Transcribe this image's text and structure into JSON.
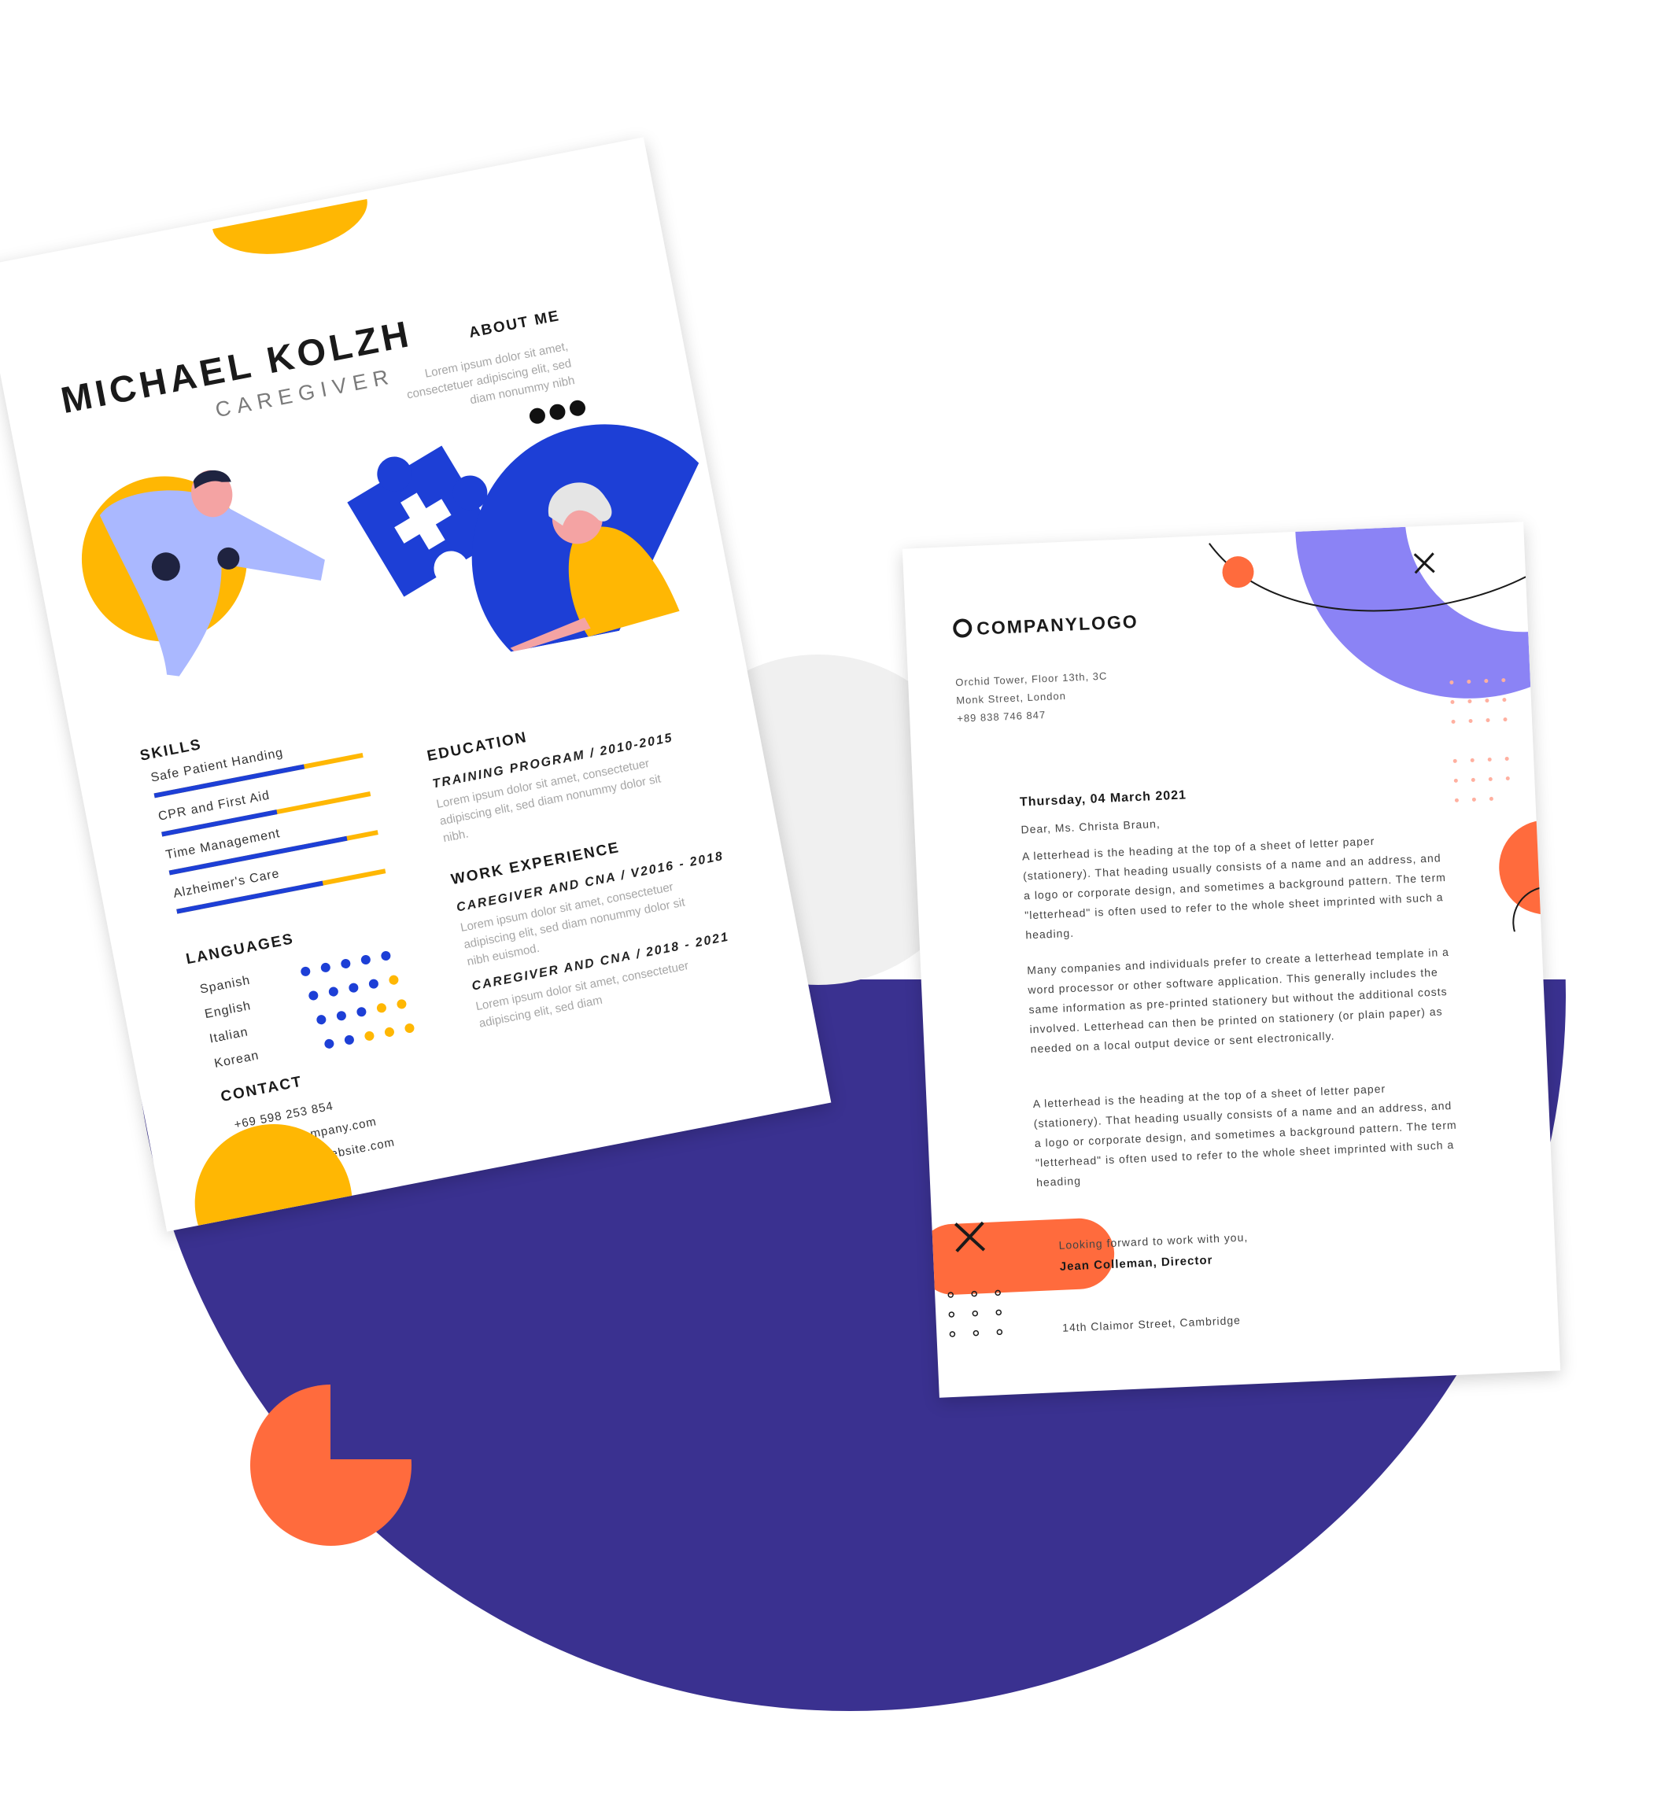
{
  "colors": {
    "navy": "#3a3190",
    "orange": "#ff6b3d",
    "yellow": "#ffb703",
    "blue": "#1d3fd6",
    "periwinkle": "#8b83f5"
  },
  "resume": {
    "name": "MICHAEL KOLZH",
    "role": "CAREGIVER",
    "about": {
      "heading": "ABOUT ME",
      "text": "Lorem ipsum dolor sit amet, consectetuer adipiscing elit, sed diam nonummy nibh",
      "social_icons": [
        "twitter-icon",
        "facebook-icon",
        "instagram-icon"
      ]
    },
    "skills": {
      "heading": "SKILLS",
      "items": [
        {
          "label": "Safe Patient Handing",
          "level": 0.72
        },
        {
          "label": "CPR and First Aid",
          "level": 0.55
        },
        {
          "label": "Time Management",
          "level": 0.85
        },
        {
          "label": "Alzheimer's Care",
          "level": 0.7
        }
      ]
    },
    "languages": {
      "heading": "LANGUAGES",
      "items": [
        {
          "label": "Spanish",
          "level": 5
        },
        {
          "label": "English",
          "level": 4
        },
        {
          "label": "Italian",
          "level": 3
        },
        {
          "label": "Korean",
          "level": 2
        }
      ],
      "max": 5
    },
    "education": {
      "heading": "EDUCATION",
      "title": "TRAINING PROGRAM  / 2010-2015",
      "text": "Lorem ipsum dolor sit amet, consectetuer adipiscing elit, sed diam nonummy dolor sit nibh."
    },
    "work": {
      "heading": "WORK EXPERIENCE",
      "jobs": [
        {
          "title": "CAREGIVER AND CNA / V2016 - 2018",
          "text": "Lorem ipsum dolor sit amet, consectetuer adipiscing elit, sed diam nonummy dolor sit nibh euismod."
        },
        {
          "title": "CAREGIVER AND CNA / 2018 - 2021",
          "text": "Lorem ipsum dolor sit amet, consectetuer adipiscing elit, sed diam"
        }
      ]
    },
    "contact": {
      "heading": "CONTACT",
      "phone": "+69 598 253 854",
      "email": "Michael@company.com",
      "website": "www.MichaelWebsite.com"
    }
  },
  "letter": {
    "logo": "COMPANYLOGO",
    "address": [
      "Orchid Tower, Floor 13th, 3C",
      "Monk Street, London",
      "+89 838 746 847"
    ],
    "date": "Thursday, 04 March 2021",
    "greeting": "Dear, Ms. Christa Braun,",
    "paragraphs": [
      "A letterhead is the heading at the top of a sheet of letter paper (stationery). That heading usually consists of a name and an address, and a logo or corporate design, and sometimes a background pattern. The term \"letterhead\" is often used to refer to the whole sheet imprinted with such a heading.",
      "Many companies and individuals prefer to create a letterhead template in a word processor or other software application. This generally includes the same information as pre-printed stationery but without the additional costs involved. Letterhead can then be printed on stationery (or plain paper) as needed on a local output device or sent electronically.",
      "A letterhead is the heading at the top of a sheet of letter paper (stationery). That heading usually consists of a name and an address, and a logo or corporate design, and sometimes a background pattern. The term \"letterhead\" is often used to refer to the whole sheet imprinted with such a heading"
    ],
    "closing": "Looking forward to work with you,",
    "signature": "Jean Colleman, Director",
    "footer": "14th Claimor Street, Cambridge"
  }
}
